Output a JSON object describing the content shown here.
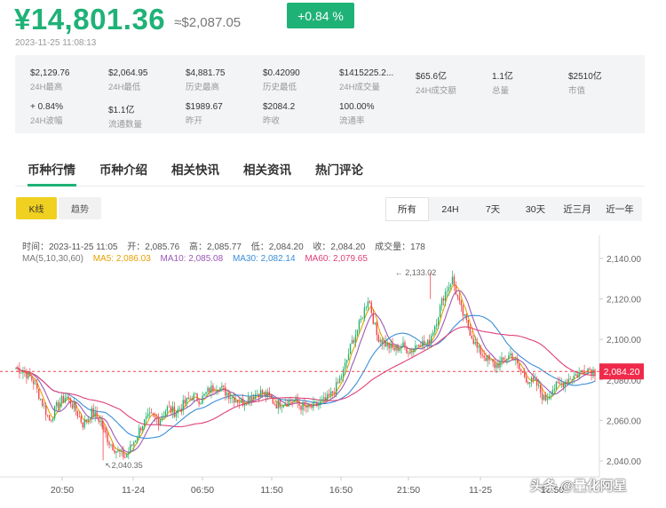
{
  "header": {
    "price": "¥14,801.36",
    "usd_price": "≈$2,087.05",
    "change": "+0.84 %",
    "timestamp": "2023-11-25 11:08:13",
    "accent": "#1fb277"
  },
  "stats": [
    {
      "value": "$2,129.76",
      "label": "24H最高"
    },
    {
      "value": "$2,064.95",
      "label": "24H最低"
    },
    {
      "value": "$4,881.75",
      "label": "历史最高"
    },
    {
      "value": "$0.42090",
      "label": "历史最低"
    },
    {
      "value": "$1415225.2...",
      "label": "24H成交量"
    },
    {
      "value": "$65.6亿",
      "label": "24H成交额"
    },
    {
      "value": "1.1亿",
      "label": "总量"
    },
    {
      "value": "$2510亿",
      "label": "市值"
    },
    {
      "value": "+ 0.84%",
      "label": "24H波幅"
    },
    {
      "value": "$1.1亿",
      "label": "流通数量"
    },
    {
      "value": "$1989.67",
      "label": "昨开"
    },
    {
      "value": "$2084.2",
      "label": "昨收"
    },
    {
      "value": "100.00%",
      "label": "流通率"
    }
  ],
  "tabs": [
    "币种行情",
    "币种介绍",
    "相关快讯",
    "相关资讯",
    "热门评论"
  ],
  "chart_types": [
    "K线",
    "趋势"
  ],
  "ranges": [
    "所有",
    "24H",
    "7天",
    "30天",
    "近三月",
    "近一年"
  ],
  "ohlc": {
    "time": "时间：2023-11-25 11:05",
    "open": "开：2,085.76",
    "high": "高：2,085.77",
    "low": "低：2,084.20",
    "close": "收：2,084.20",
    "volume": "成交量：178"
  },
  "ma": {
    "label": "MA(5,10,30,60)",
    "ma5": "MA5: 2,086.03",
    "ma10": "MA10: 2,085.08",
    "ma30": "MA30: 2,082.14",
    "ma60": "MA60: 2,079.65",
    "colors": {
      "ma5": "#e8a000",
      "ma10": "#9b59b6",
      "ma30": "#3b8fd9",
      "ma60": "#e0407a"
    }
  },
  "chart_data": {
    "type": "candlestick",
    "x_ticks": [
      "20:50",
      "11-24",
      "06:50",
      "11:50",
      "16:50",
      "21:50",
      "11-25",
      "16:50"
    ],
    "y_ticks": [
      "2,140.00",
      "2,120.00",
      "2,100.00",
      "2,080.00",
      "2,060.00",
      "2,040.00"
    ],
    "ylim": [
      2035,
      2145
    ],
    "current_price": 2084.2,
    "current_price_label": "2,084.20",
    "annotations": [
      {
        "text": "2,133.02",
        "value": 2133.02
      },
      {
        "text": "2,040.35",
        "value": 2040.35
      }
    ],
    "ma_colors": {
      "ma5": "#e8a000",
      "ma10": "#9b59b6",
      "ma30": "#3b8fd9",
      "ma60": "#e0407a"
    },
    "trend": [
      2086,
      2084,
      2080,
      2070,
      2060,
      2068,
      2072,
      2066,
      2058,
      2064,
      2060,
      2050,
      2045,
      2042,
      2049,
      2058,
      2062,
      2060,
      2066,
      2064,
      2068,
      2072,
      2070,
      2075,
      2077,
      2074,
      2071,
      2069,
      2072,
      2074,
      2072,
      2068,
      2069,
      2070,
      2067,
      2066,
      2068,
      2070,
      2075,
      2084,
      2098,
      2108,
      2121,
      2102,
      2098,
      2095,
      2097,
      2094,
      2099,
      2097,
      2108,
      2122,
      2130,
      2115,
      2105,
      2095,
      2091,
      2087,
      2089,
      2093,
      2085,
      2080,
      2078,
      2070,
      2076,
      2078,
      2081,
      2083,
      2086,
      2084
    ]
  },
  "watermark": "头条 @量化阿星"
}
